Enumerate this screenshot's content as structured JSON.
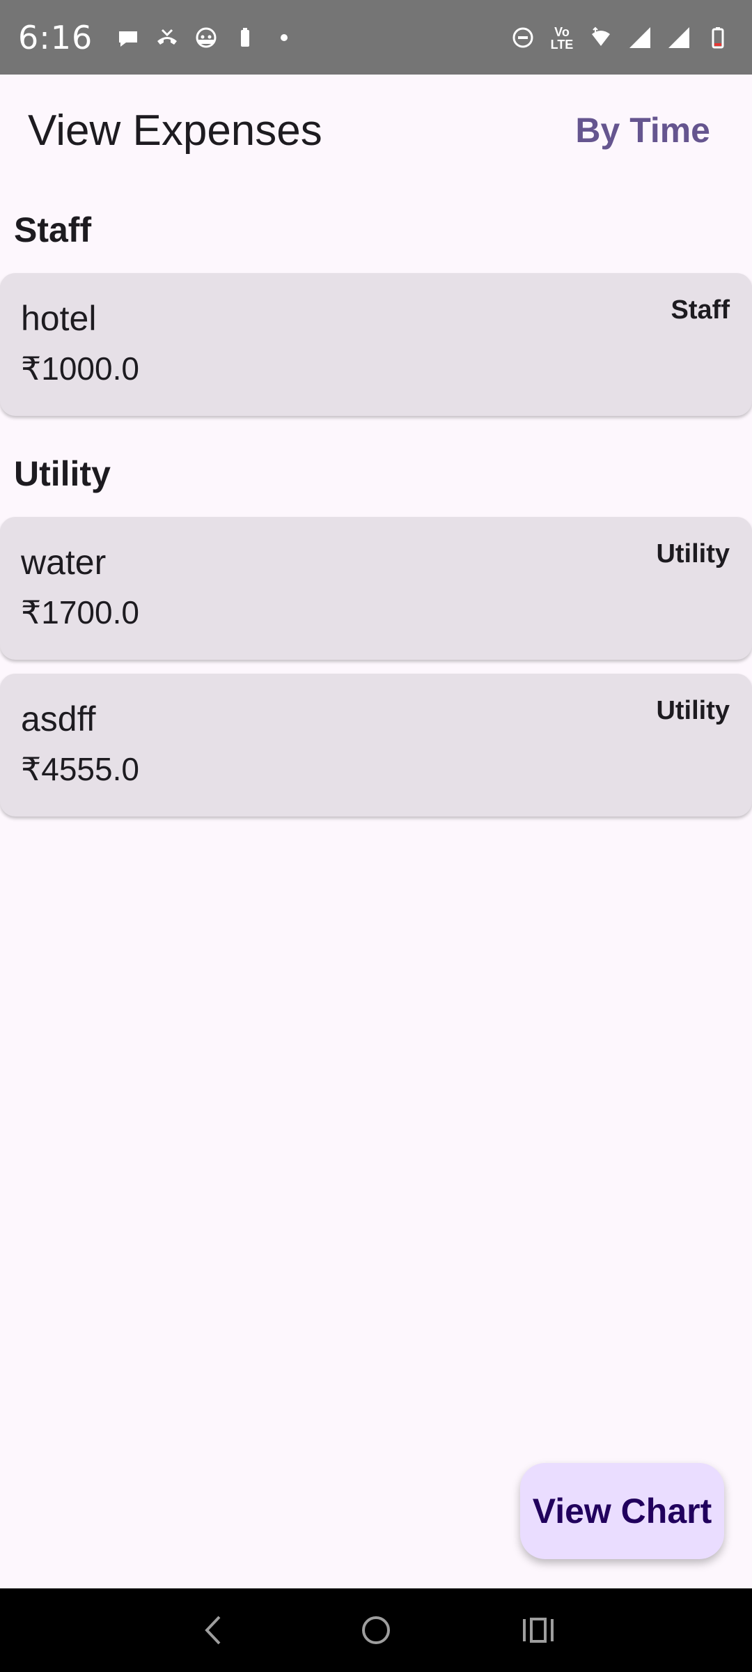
{
  "status_bar": {
    "time": "6:16",
    "network_label": "Vo LTE",
    "icons": [
      "chat-icon",
      "missed-call-icon",
      "android-icon",
      "battery-saver-icon",
      "dot-icon",
      "do-not-disturb-icon",
      "volte-icon",
      "wifi-icon",
      "signal-icon",
      "signal-icon",
      "battery-icon"
    ]
  },
  "app_bar": {
    "title": "View Expenses",
    "toggle_label": "By Time",
    "accent_color": "#65558f"
  },
  "groups": [
    {
      "header": "Staff",
      "items": [
        {
          "name": "hotel",
          "amount": "₹1000.0",
          "category": "Staff"
        }
      ]
    },
    {
      "header": "Utility",
      "items": [
        {
          "name": "water",
          "amount": "₹1700.0",
          "category": "Utility"
        },
        {
          "name": "asdff",
          "amount": "₹4555.0",
          "category": "Utility"
        }
      ]
    }
  ],
  "fab": {
    "label": "View Chart",
    "background": "#eaddff"
  },
  "nav_bar": {
    "icons": [
      "back-icon",
      "home-icon",
      "recents-icon"
    ]
  }
}
